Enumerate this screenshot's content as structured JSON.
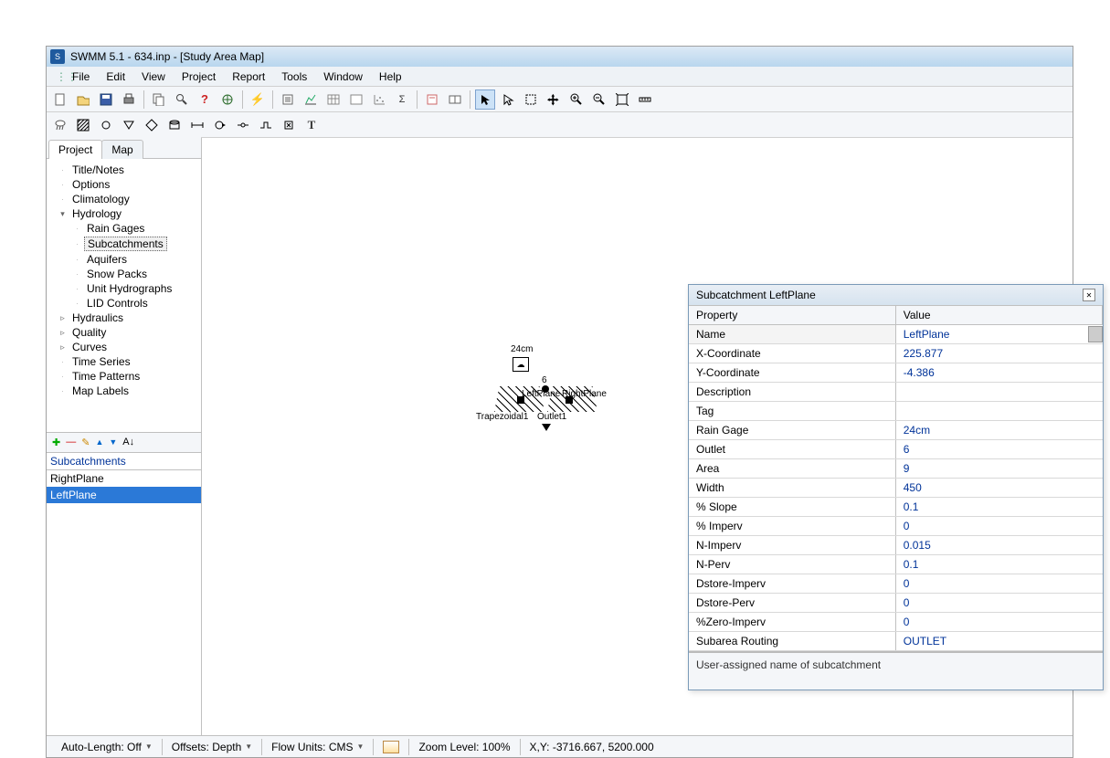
{
  "title": "SWMM 5.1 - 634.inp - [Study Area Map]",
  "menu": [
    "File",
    "Edit",
    "View",
    "Project",
    "Report",
    "Tools",
    "Window",
    "Help"
  ],
  "tabs": {
    "project": "Project",
    "map": "Map"
  },
  "tree": {
    "items": [
      {
        "label": "Title/Notes",
        "indent": 0,
        "tw": ""
      },
      {
        "label": "Options",
        "indent": 0,
        "tw": ""
      },
      {
        "label": "Climatology",
        "indent": 0,
        "tw": ""
      },
      {
        "label": "Hydrology",
        "indent": 0,
        "tw": "▾"
      },
      {
        "label": "Rain Gages",
        "indent": 1,
        "tw": ""
      },
      {
        "label": "Subcatchments",
        "indent": 1,
        "tw": "",
        "selected": true
      },
      {
        "label": "Aquifers",
        "indent": 1,
        "tw": ""
      },
      {
        "label": "Snow Packs",
        "indent": 1,
        "tw": ""
      },
      {
        "label": "Unit Hydrographs",
        "indent": 1,
        "tw": ""
      },
      {
        "label": "LID Controls",
        "indent": 1,
        "tw": ""
      },
      {
        "label": "Hydraulics",
        "indent": 0,
        "tw": "▹"
      },
      {
        "label": "Quality",
        "indent": 0,
        "tw": "▹"
      },
      {
        "label": "Curves",
        "indent": 0,
        "tw": "▹"
      },
      {
        "label": "Time Series",
        "indent": 0,
        "tw": ""
      },
      {
        "label": "Time Patterns",
        "indent": 0,
        "tw": ""
      },
      {
        "label": "Map Labels",
        "indent": 0,
        "tw": ""
      }
    ]
  },
  "list": {
    "title": "Subcatchments",
    "items": [
      {
        "label": "RightPlane",
        "selected": false
      },
      {
        "label": "LeftPlane",
        "selected": true
      }
    ]
  },
  "map": {
    "raingage_label": "24cm",
    "junction_label": "6",
    "left_label": "LeftPlane",
    "right_label": "RightPlane",
    "conduit_label": "Trapezoidal1",
    "outlet_label": "Outlet1"
  },
  "property_panel": {
    "title": "Subcatchment LeftPlane",
    "col_property": "Property",
    "col_value": "Value",
    "rows": [
      {
        "k": "Name",
        "v": "LeftPlane"
      },
      {
        "k": "X-Coordinate",
        "v": "225.877"
      },
      {
        "k": "Y-Coordinate",
        "v": "-4.386"
      },
      {
        "k": "Description",
        "v": ""
      },
      {
        "k": "Tag",
        "v": ""
      },
      {
        "k": "Rain Gage",
        "v": "24cm"
      },
      {
        "k": "Outlet",
        "v": "6"
      },
      {
        "k": "Area",
        "v": "9"
      },
      {
        "k": "Width",
        "v": "450"
      },
      {
        "k": "% Slope",
        "v": "0.1"
      },
      {
        "k": "% Imperv",
        "v": "0"
      },
      {
        "k": "N-Imperv",
        "v": "0.015"
      },
      {
        "k": "N-Perv",
        "v": "0.1"
      },
      {
        "k": "Dstore-Imperv",
        "v": "0"
      },
      {
        "k": "Dstore-Perv",
        "v": "0"
      },
      {
        "k": "%Zero-Imperv",
        "v": "0"
      },
      {
        "k": "Subarea Routing",
        "v": "OUTLET"
      }
    ],
    "description": "User-assigned name of subcatchment"
  },
  "status": {
    "auto_length": "Auto-Length: Off",
    "offsets": "Offsets: Depth",
    "flow_units": "Flow Units: CMS",
    "zoom": "Zoom Level: 100%",
    "coords": "X,Y: -3716.667, 5200.000"
  },
  "icons": {
    "plus": "✚",
    "minus": "—",
    "pencil": "✎",
    "up": "▲",
    "down": "▼",
    "sort": "A↓"
  }
}
